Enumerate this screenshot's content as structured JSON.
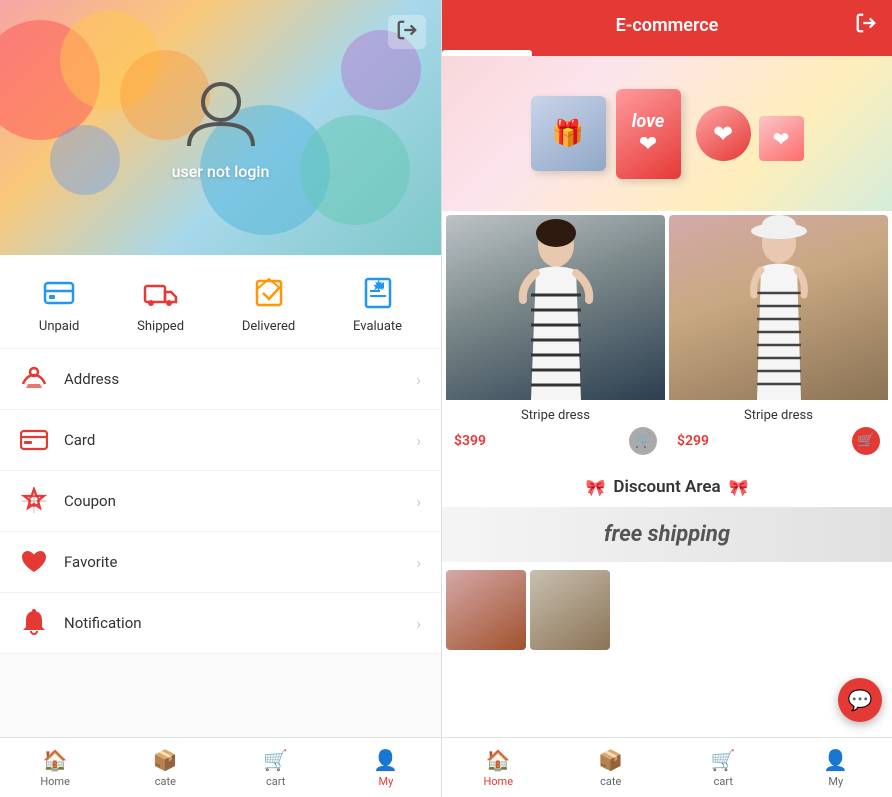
{
  "left": {
    "header": {
      "user_status": "user not login",
      "exit_icon": "→"
    },
    "order_section": {
      "items": [
        {
          "id": "unpaid",
          "label": "Unpaid",
          "icon": "wallet"
        },
        {
          "id": "shipped",
          "label": "Shipped",
          "icon": "truck"
        },
        {
          "id": "delivered",
          "label": "Delivered",
          "icon": "inbox"
        },
        {
          "id": "evaluate",
          "label": "Evaluate",
          "icon": "edit"
        }
      ]
    },
    "menu": [
      {
        "id": "address",
        "label": "Address",
        "icon": "cart"
      },
      {
        "id": "card",
        "label": "Card",
        "icon": "card"
      },
      {
        "id": "coupon",
        "label": "Coupon",
        "icon": "star"
      },
      {
        "id": "favorite",
        "label": "Favorite",
        "icon": "heart"
      },
      {
        "id": "notification",
        "label": "Notification",
        "icon": "bell"
      }
    ],
    "bottom_nav": [
      {
        "id": "home",
        "label": "Home",
        "icon": "🏠",
        "active": false
      },
      {
        "id": "cate",
        "label": "cate",
        "icon": "📦",
        "active": false
      },
      {
        "id": "cart",
        "label": "cart",
        "icon": "🛒",
        "active": false
      },
      {
        "id": "my",
        "label": "My",
        "icon": "👤",
        "active": true
      }
    ]
  },
  "right": {
    "header": {
      "title": "E-commerce",
      "exit_icon": "→"
    },
    "tabs": [
      {
        "id": "tab1",
        "active": true
      },
      {
        "id": "tab2",
        "active": false
      },
      {
        "id": "tab3",
        "active": false
      },
      {
        "id": "tab4",
        "active": false
      },
      {
        "id": "tab5",
        "active": false
      }
    ],
    "products": [
      {
        "id": "prod1",
        "name": "Stripe dress",
        "price": "$399",
        "color_scheme": "dark"
      },
      {
        "id": "prod2",
        "name": "Stripe dress",
        "price": "$299",
        "color_scheme": "warm"
      }
    ],
    "discount_section": {
      "label": "Discount Area",
      "icon_left": "🎀",
      "icon_right": "🎀"
    },
    "free_shipping_text": "free shipping",
    "bottom_nav": [
      {
        "id": "home",
        "label": "Home",
        "icon": "🏠",
        "active": true
      },
      {
        "id": "cate",
        "label": "cate",
        "icon": "📦",
        "active": false
      },
      {
        "id": "cart",
        "label": "cart",
        "icon": "🛒",
        "active": false
      },
      {
        "id": "my",
        "label": "My",
        "icon": "👤",
        "active": false
      }
    ]
  }
}
